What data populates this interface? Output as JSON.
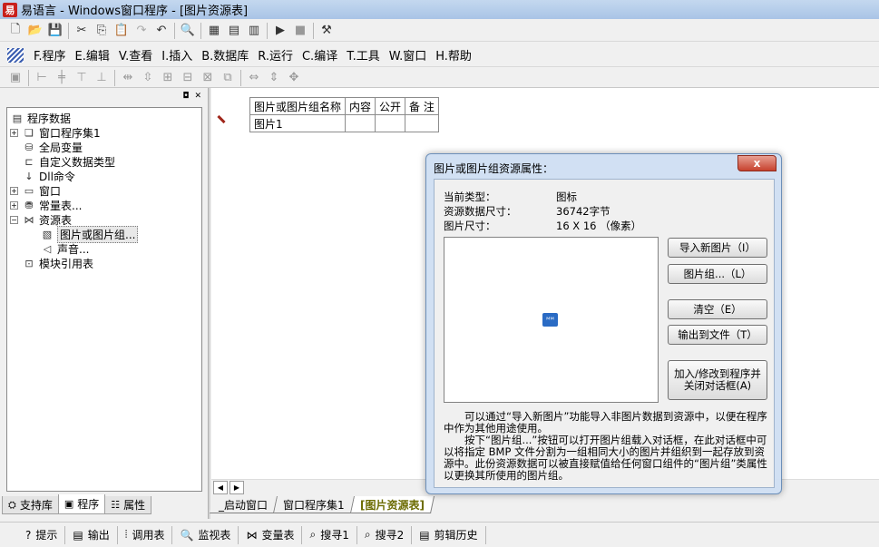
{
  "window": {
    "title": "易语言 - Windows窗口程序 - [图片资源表]",
    "app_icon_label": "易"
  },
  "menu": [
    "F.程序",
    "E.编辑",
    "V.查看",
    "I.插入",
    "B.数据库",
    "R.运行",
    "C.编译",
    "T.工具",
    "W.窗口",
    "H.帮助"
  ],
  "tree": {
    "items": [
      {
        "label": "程序数据",
        "icon": "program-data-icon",
        "level": 0,
        "expander": ""
      },
      {
        "label": "窗口程序集1",
        "icon": "module-icon",
        "level": 1,
        "expander": "+"
      },
      {
        "label": "全局变量",
        "icon": "variable-icon",
        "level": 1,
        "expander": ""
      },
      {
        "label": "自定义数据类型",
        "icon": "datatype-icon",
        "level": 1,
        "expander": ""
      },
      {
        "label": "Dll命令",
        "icon": "dll-icon",
        "level": 1,
        "expander": ""
      },
      {
        "label": "窗口",
        "icon": "window-icon",
        "level": 1,
        "expander": "+"
      },
      {
        "label": "常量表...",
        "icon": "constant-icon",
        "level": 1,
        "expander": "+"
      },
      {
        "label": "资源表",
        "icon": "resource-icon",
        "level": 1,
        "expander": "−"
      },
      {
        "label": "图片或图片组...",
        "icon": "image-icon",
        "level": 2,
        "expander": "",
        "selected": true
      },
      {
        "label": "声音...",
        "icon": "sound-icon",
        "level": 2,
        "expander": ""
      },
      {
        "label": "模块引用表",
        "icon": "module-ref-icon",
        "level": 1,
        "expander": ""
      }
    ]
  },
  "left_tabs": [
    "支持库",
    "程序",
    "属性"
  ],
  "resource_table": {
    "headers": [
      "图片或图片组名称",
      "内容",
      "公开",
      "备 注"
    ],
    "rows": [
      [
        "图片1",
        "",
        "",
        ""
      ]
    ]
  },
  "doc_tabs": [
    "_启动窗口",
    "窗口程序集1",
    "[图片资源表]"
  ],
  "status_items": [
    "提示",
    "输出",
    "调用表",
    "监视表",
    "变量表",
    "搜寻1",
    "搜寻2",
    "剪辑历史"
  ],
  "dialog": {
    "title": "图片或图片组资源属性：",
    "close_label": "x",
    "props": [
      {
        "label": "当前类型：",
        "value": "图标"
      },
      {
        "label": "资源数据尺寸：",
        "value": "36742字节"
      },
      {
        "label": "图片尺寸：",
        "value": "16 X 16 （像素）"
      }
    ],
    "buttons": [
      "导入新图片（I）",
      "图片组...（L）",
      "清空（E）",
      "输出到文件（T）",
      "加入/修改到程序并关闭对话框(A)"
    ],
    "help1": "可以通过“导入新图片”功能导入非图片数据到资源中，以便在程序中作为其他用途使用。",
    "help2": "按下“图片组...”按钮可以打开图片组载入对话框，在此对话框中可以将指定 BMP 文件分割为一组相同大小的图片并组织到一起存放到资源中。此份资源数据可以被直接赋值给任何窗口组件的“图片组”类属性以更换其所使用的图片组。"
  }
}
